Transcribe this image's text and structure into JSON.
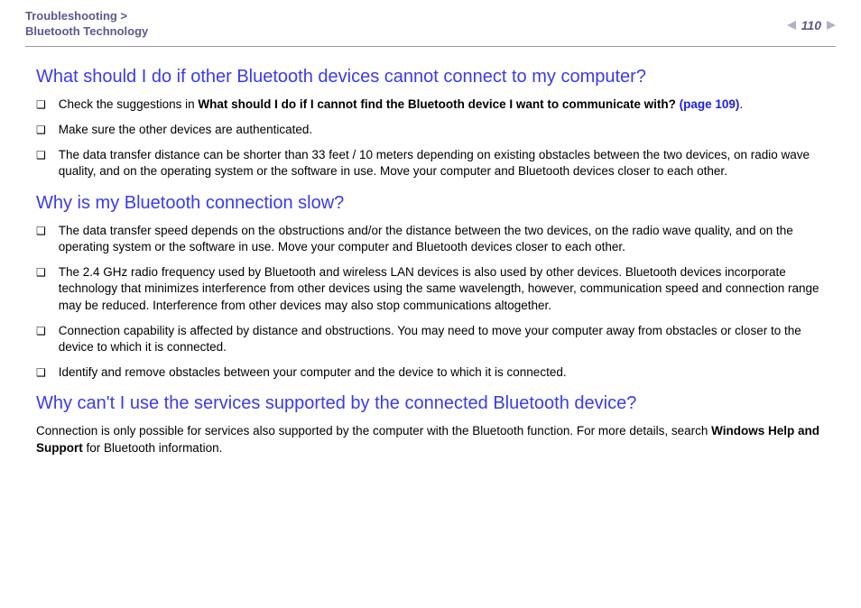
{
  "header": {
    "breadcrumb_line1": "Troubleshooting >",
    "breadcrumb_line2": "Bluetooth Technology",
    "page_number": "110"
  },
  "sections": [
    {
      "heading": "What should I do if other Bluetooth devices cannot connect to my computer?",
      "items": [
        {
          "pre": "Check the suggestions in ",
          "bold": "What should I do if I cannot find the Bluetooth device I want to communicate with? ",
          "link": "(page 109)",
          "post": "."
        },
        {
          "text": "Make sure the other devices are authenticated."
        },
        {
          "text": "The data transfer distance can be shorter than 33 feet / 10 meters depending on existing obstacles between the two devices, on radio wave quality, and on the operating system or the software in use. Move your computer and Bluetooth devices closer to each other."
        }
      ]
    },
    {
      "heading": "Why is my Bluetooth connection slow?",
      "items": [
        {
          "text": "The data transfer speed depends on the obstructions and/or the distance between the two devices, on the radio wave quality, and on the operating system or the software in use. Move your computer and Bluetooth devices closer to each other."
        },
        {
          "text": "The 2.4 GHz radio frequency used by Bluetooth and wireless LAN devices is also used by other devices. Bluetooth devices incorporate technology that minimizes interference from other devices using the same wavelength, however, communication speed and connection range may be reduced. Interference from other devices may also stop communications altogether."
        },
        {
          "text": "Connection capability is affected by distance and obstructions. You may need to move your computer away from obstacles or closer to the device to which it is connected."
        },
        {
          "text": "Identify and remove obstacles between your computer and the device to which it is connected."
        }
      ]
    },
    {
      "heading": "Why can't I use the services supported by the connected Bluetooth device?",
      "paragraph": {
        "pre": "Connection is only possible for services also supported by the computer with the Bluetooth function. For more details, search ",
        "bold": "Windows Help and Support",
        "post": " for Bluetooth information."
      }
    }
  ]
}
